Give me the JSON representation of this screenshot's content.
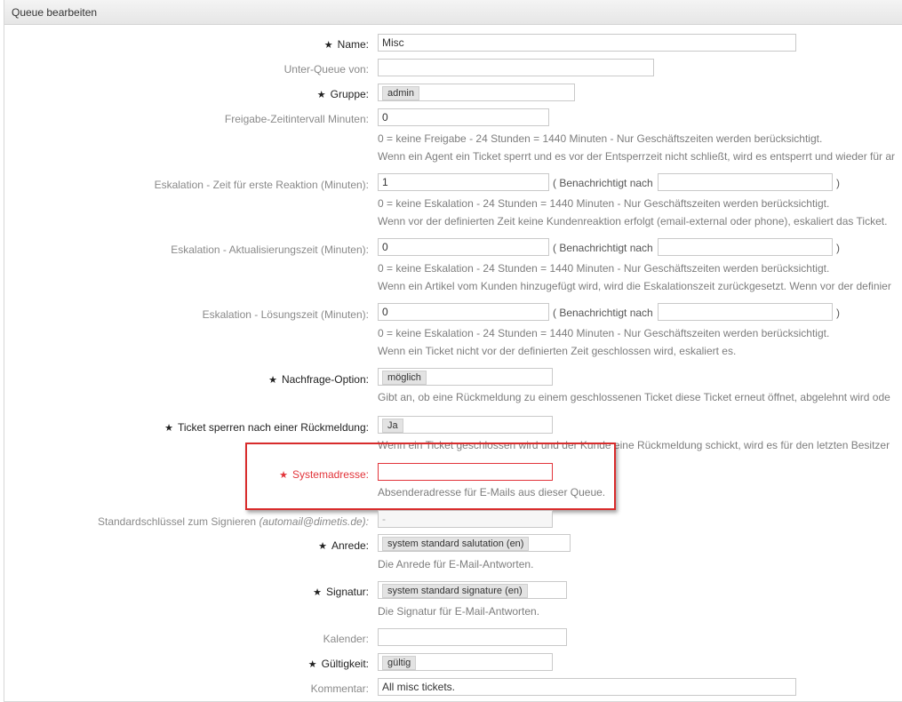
{
  "header": {
    "title": "Queue bearbeiten"
  },
  "form": {
    "name": {
      "label": "Name:",
      "value": "Misc"
    },
    "subqueue": {
      "label": "Unter-Queue von:",
      "value": ""
    },
    "group": {
      "label": "Gruppe:",
      "value": "admin"
    },
    "unlock_timeout": {
      "label": "Freigabe-Zeitintervall Minuten:",
      "value": "0",
      "hint1": "0 = keine Freigabe - 24 Stunden = 1440 Minuten - Nur Geschäftszeiten werden berücksichtigt.",
      "hint2": "Wenn ein Agent ein Ticket sperrt und es vor der Entsperrzeit nicht schließt, wird es entsperrt und wieder für ar"
    },
    "first_response": {
      "label": "Eskalation - Zeit für erste Reaktion (Minuten):",
      "value": "1",
      "notify_label": "( Benachrichtigt nach",
      "notify_close": ")",
      "notify_value": "",
      "hint1": "0 = keine Eskalation - 24 Stunden = 1440 Minuten - Nur Geschäftszeiten werden berücksichtigt.",
      "hint2": "Wenn vor der definierten Zeit keine Kundenreaktion erfolgt (email-external oder phone), eskaliert das Ticket."
    },
    "update_time": {
      "label": "Eskalation - Aktualisierungszeit (Minuten):",
      "value": "0",
      "notify_label": "( Benachrichtigt nach",
      "notify_close": ")",
      "notify_value": "",
      "hint1": "0 = keine Eskalation - 24 Stunden = 1440 Minuten - Nur Geschäftszeiten werden berücksichtigt.",
      "hint2": "Wenn ein Artikel vom Kunden hinzugefügt wird, wird die Eskalationszeit zurückgesetzt. Wenn vor der definier"
    },
    "solution_time": {
      "label": "Eskalation - Lösungszeit (Minuten):",
      "value": "0",
      "notify_label": "( Benachrichtigt nach",
      "notify_close": ")",
      "notify_value": "",
      "hint1": "0 = keine Eskalation - 24 Stunden = 1440 Minuten - Nur Geschäftszeiten werden berücksichtigt.",
      "hint2": "Wenn ein Ticket nicht vor der definierten Zeit geschlossen wird, eskaliert es."
    },
    "follow_up": {
      "label": "Nachfrage-Option:",
      "value": "möglich",
      "hint": "Gibt an, ob eine Rückmeldung zu einem geschlossenen Ticket diese Ticket erneut öffnet, abgelehnt wird ode"
    },
    "follow_up_lock": {
      "label": "Ticket sperren nach einer Rückmeldung:",
      "value": "Ja",
      "hint": "Wenn ein Ticket geschlossen wird und der Kunde eine Rückmeldung schickt, wird es für den letzten Besitzer"
    },
    "system_address": {
      "label": "Systemadresse:",
      "value": "",
      "hint": "Absenderadresse für E-Mails aus dieser Queue."
    },
    "signing_key": {
      "label": "Standardschlüssel zum Signieren",
      "label_email": "(automail@dimetis.de):",
      "value": "-"
    },
    "salutation": {
      "label": "Anrede:",
      "value": "system standard salutation (en)",
      "hint": "Die Anrede für E-Mail-Antworten."
    },
    "signature": {
      "label": "Signatur:",
      "value": "system standard signature (en)",
      "hint": "Die Signatur für E-Mail-Antworten."
    },
    "calendar": {
      "label": "Kalender:",
      "value": ""
    },
    "validity": {
      "label": "Gültigkeit:",
      "value": "gültig"
    },
    "comment": {
      "label": "Kommentar:",
      "value": "All misc tickets."
    }
  },
  "required_marker": "★",
  "colors": {
    "error": "#e2343a",
    "highlight_box": "#d82c2c",
    "header_bg": "#e9e9e9"
  }
}
